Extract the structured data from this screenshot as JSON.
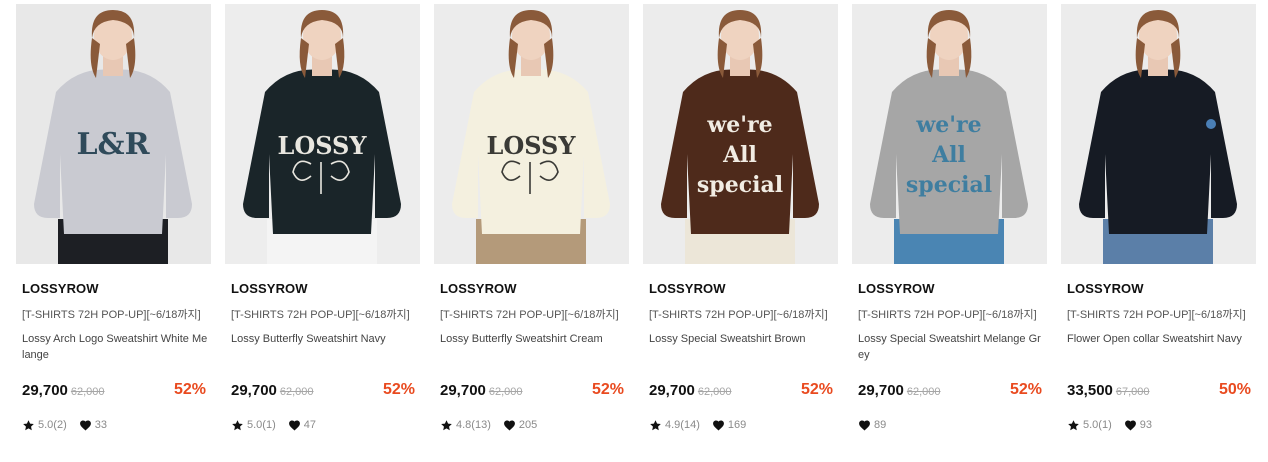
{
  "colors": {
    "discount": "#e94a1f",
    "strike_price": "#a6a6a6",
    "icon": "#111111"
  },
  "products": [
    {
      "brand": "LOSSYROW",
      "promo": "[T-SHIRTS 72H POP-UP][~6/18까지]",
      "name": "Lossy Arch Logo Sweatshirt White Melange",
      "price": "29,700",
      "original_price": "62,000",
      "discount": "52%",
      "rating": "5.0(2)",
      "likes": "33",
      "image": {
        "description_icon": "product-photo",
        "bg": "#e8e8e8",
        "sweater_color": "#c9cad1",
        "print_text": [
          "L&R"
        ],
        "print_color": "#2f4a5a",
        "bottom_color": "#1d1f24"
      }
    },
    {
      "brand": "LOSSYROW",
      "promo": "[T-SHIRTS 72H POP-UP][~6/18까지]",
      "name": "Lossy Butterfly Sweatshirt Navy",
      "price": "29,700",
      "original_price": "62,000",
      "discount": "52%",
      "rating": "5.0(1)",
      "likes": "47",
      "image": {
        "description_icon": "product-photo",
        "bg": "#ededed",
        "sweater_color": "#1a2529",
        "print_text": [
          "LOSSY"
        ],
        "print_color": "#e8e6df",
        "bottom_color": "#f4f4f4"
      }
    },
    {
      "brand": "LOSSYROW",
      "promo": "[T-SHIRTS 72H POP-UP][~6/18까지]",
      "name": "Lossy Butterfly Sweatshirt Cream",
      "price": "29,700",
      "original_price": "62,000",
      "discount": "52%",
      "rating": "4.8(13)",
      "likes": "205",
      "image": {
        "description_icon": "product-photo",
        "bg": "#ececec",
        "sweater_color": "#f4f0df",
        "print_text": [
          "LOSSY"
        ],
        "print_color": "#3a3a36",
        "bottom_color": "#b49a7a"
      }
    },
    {
      "brand": "LOSSYROW",
      "promo": "[T-SHIRTS 72H POP-UP][~6/18까지]",
      "name": "Lossy Special Sweatshirt Brown",
      "price": "29,700",
      "original_price": "62,000",
      "discount": "52%",
      "rating": "4.9(14)",
      "likes": "169",
      "image": {
        "description_icon": "product-photo",
        "bg": "#ececec",
        "sweater_color": "#4e2a1b",
        "print_text": [
          "we're",
          "All",
          "special"
        ],
        "print_color": "#f1ece3",
        "bottom_color": "#ece6d8"
      }
    },
    {
      "brand": "LOSSYROW",
      "promo": "[T-SHIRTS 72H POP-UP][~6/18까지]",
      "name": "Lossy Special Sweatshirt Melange Grey",
      "price": "29,700",
      "original_price": "62,000",
      "discount": "52%",
      "rating": "",
      "likes": "89",
      "image": {
        "description_icon": "product-photo",
        "bg": "#ececec",
        "sweater_color": "#a6a6a6",
        "print_text": [
          "we're",
          "All",
          "special"
        ],
        "print_color": "#3f7ea0",
        "bottom_color": "#4a85b3"
      }
    },
    {
      "brand": "LOSSYROW",
      "promo": "[T-SHIRTS 72H POP-UP][~6/18까지]",
      "name": "Flower Open collar Sweatshirt Navy",
      "price": "33,500",
      "original_price": "67,000",
      "discount": "50%",
      "rating": "5.0(1)",
      "likes": "93",
      "image": {
        "description_icon": "product-photo",
        "bg": "#ececec",
        "sweater_color": "#161b24",
        "print_text": [],
        "print_color": "#4a7fb6",
        "bottom_color": "#5b7fa8"
      }
    }
  ]
}
